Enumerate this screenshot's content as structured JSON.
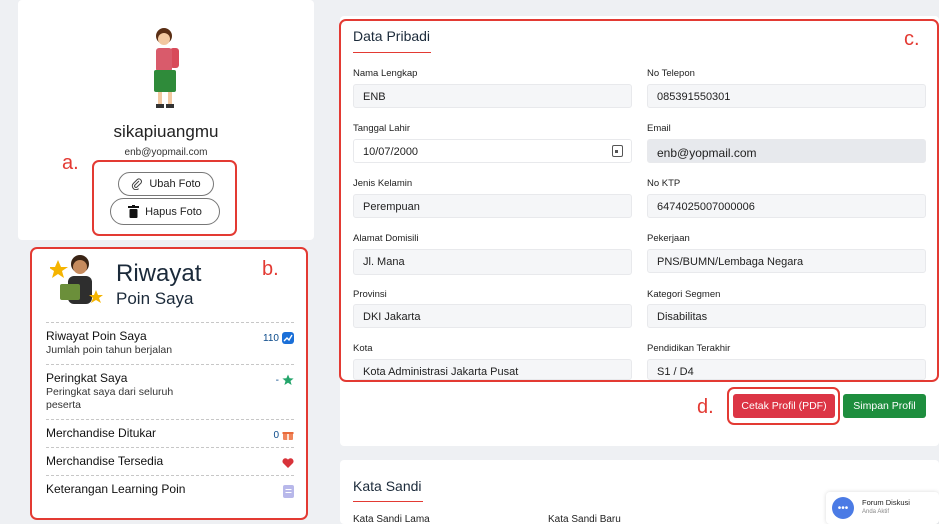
{
  "profile": {
    "name": "sikapiuangmu",
    "email": "enb@yopmail.com",
    "change_photo_label": "Ubah Foto",
    "delete_photo_label": "Hapus Foto"
  },
  "annotations": {
    "a": "a.",
    "b": "b.",
    "c": "c.",
    "d": "d."
  },
  "poin": {
    "title_line1": "Riwayat",
    "title_line2": "Poin Saya",
    "items": [
      {
        "title": "Riwayat Poin Saya",
        "subtitle": "Jumlah poin tahun berjalan",
        "value": "110",
        "icon": "chart-line-icon"
      },
      {
        "title": "Peringkat Saya",
        "subtitle": "Peringkat saya dari seluruh peserta",
        "value": "-",
        "icon": "star-icon"
      },
      {
        "title": "Merchandise Ditukar",
        "subtitle": "",
        "value": "0",
        "icon": "gift-icon"
      },
      {
        "title": "Merchandise Tersedia",
        "subtitle": "",
        "value": "",
        "icon": "heart-icon"
      },
      {
        "title": "Keterangan Learning Poin",
        "subtitle": "",
        "value": "",
        "icon": "document-icon"
      }
    ]
  },
  "data_pribadi": {
    "title": "Data Pribadi",
    "fields": {
      "nama_label": "Nama Lengkap",
      "nama_value": "ENB",
      "telepon_label": "No Telepon",
      "telepon_value": "085391550301",
      "lahir_label": "Tanggal Lahir",
      "lahir_value": "10/07/2000",
      "email_label": "Email",
      "email_value": "enb@yopmail.com",
      "kelamin_label": "Jenis Kelamin",
      "kelamin_value": "Perempuan",
      "ktp_label": "No KTP",
      "ktp_value": "6474025007000006",
      "alamat_label": "Alamat Domisili",
      "alamat_value": "Jl. Mana",
      "pekerjaan_label": "Pekerjaan",
      "pekerjaan_value": "PNS/BUMN/Lembaga Negara",
      "provinsi_label": "Provinsi",
      "provinsi_value": "DKI Jakarta",
      "segmen_label": "Kategori Segmen",
      "segmen_value": "Disabilitas",
      "kota_label": "Kota",
      "kota_value": "Kota Administrasi Jakarta Pusat",
      "pendidikan_label": "Pendidikan Terakhir",
      "pendidikan_value": "S1 / D4"
    },
    "print_pdf_label": "Cetak Profil (PDF)",
    "save_label": "Simpan Profil"
  },
  "password": {
    "title": "Kata Sandi",
    "old_label": "Kata Sandi Lama",
    "new_label": "Kata Sandi Baru"
  },
  "forum": {
    "title": "Forum Diskusi",
    "status": "Anda Aktif",
    "bubble": "•••"
  },
  "colors": {
    "accent_red": "#e33a33",
    "pdf_button": "#dc3545",
    "save_button": "#1e8e3e"
  }
}
